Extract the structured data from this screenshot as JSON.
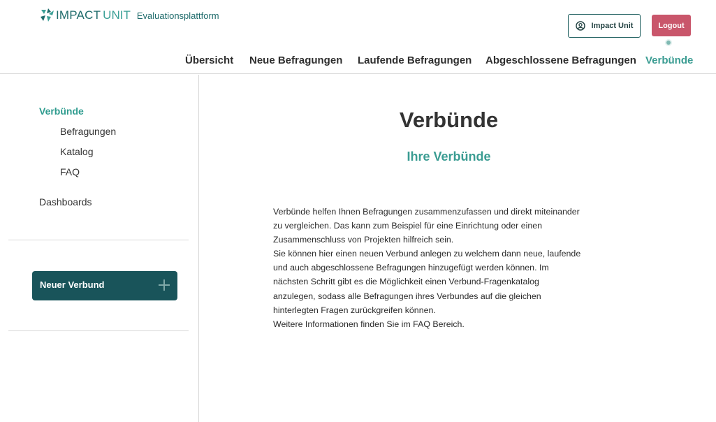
{
  "brand": {
    "name_impact": "IMPACT",
    "name_unit": "UNIT",
    "subtitle": "Evaluationsplattform"
  },
  "header": {
    "user_button_label": "Impact Unit",
    "logout_label": "Logout"
  },
  "topnav": {
    "items": [
      {
        "label": "Übersicht",
        "active": false
      },
      {
        "label": "Neue Befragungen",
        "active": false
      },
      {
        "label": "Laufende Befragungen",
        "active": false
      },
      {
        "label": "Abgeschlossene Befragungen",
        "active": false
      },
      {
        "label": "Verbünde",
        "active": true
      }
    ]
  },
  "sidebar": {
    "items": [
      {
        "label": "Verbünde",
        "active": true
      },
      {
        "label": "Befragungen"
      },
      {
        "label": "Katalog"
      },
      {
        "label": "FAQ"
      },
      {
        "label": "Dashboards"
      }
    ],
    "new_button_label": "Neuer Verbund"
  },
  "main": {
    "title": "Verbünde",
    "subtitle": "Ihre Verbünde",
    "intro_lines": [
      "Verbünde helfen Ihnen Befragungen zusammenzufassen und direkt miteinander",
      "zu vergleichen. Das kann zum Beispiel für eine Einrichtung oder einen",
      "Zusammenschluss von Projekten hilfreich sein.",
      "Sie können hier einen neuen Verbund anlegen zu welchem dann neue, laufende",
      "und auch abgeschlossene Befragungen hinzugefügt werden können. Im",
      "nächsten Schritt gibt es die Möglichkeit einen Verbund-Fragenkatalog",
      "anzulegen, sodass alle Befragungen ihres Verbundes auf die gleichen",
      "hinterlegten Fragen zurückgreifen können.",
      "Weitere Informationen finden Sie im FAQ Bereich."
    ]
  },
  "colors": {
    "accent": "#3a9c92",
    "dark_teal": "#19545a",
    "logout": "#c9566b"
  }
}
